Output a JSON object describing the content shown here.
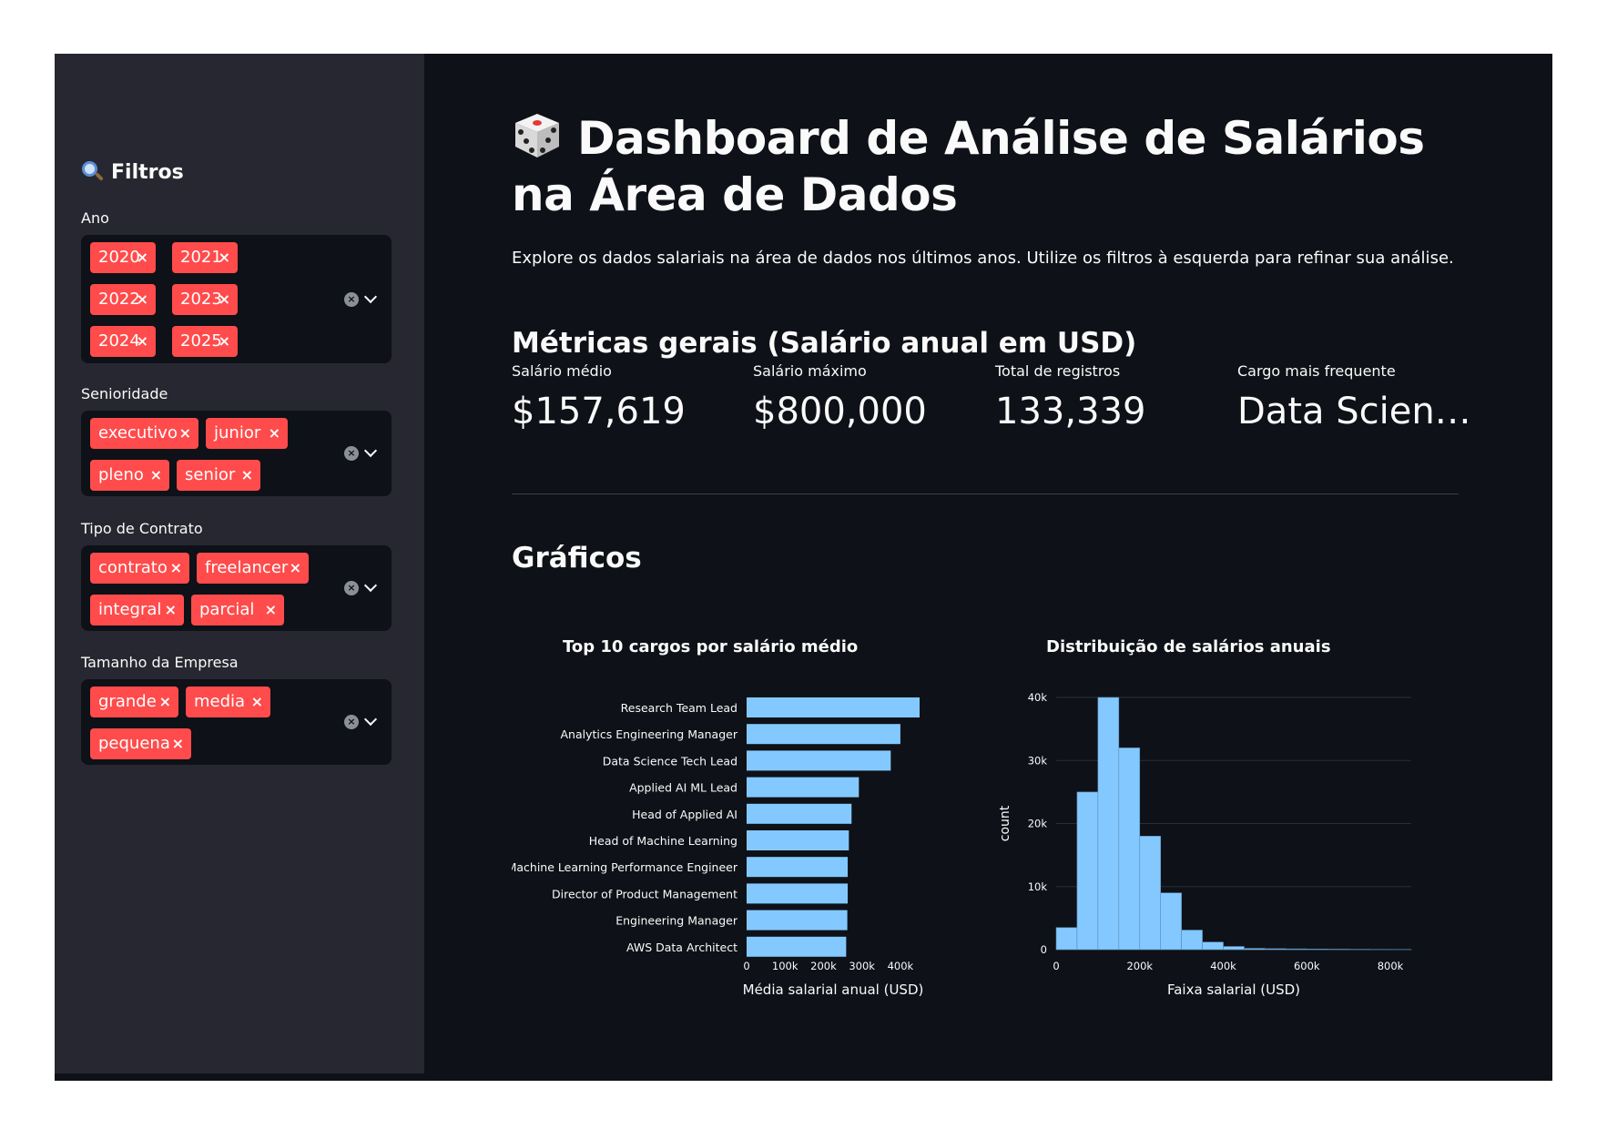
{
  "sidebar": {
    "title": "Filtros",
    "title_icon": "magnifier-icon",
    "filters": {
      "ano": {
        "label": "Ano",
        "tags": [
          "2020",
          "2021",
          "2022",
          "2023",
          "2024",
          "2025"
        ]
      },
      "senioridade": {
        "label": "Senioridade",
        "tags": [
          "executivo",
          "junior",
          "pleno",
          "senior"
        ]
      },
      "contrato": {
        "label": "Tipo de Contrato",
        "tags": [
          "contrato",
          "freelancer",
          "integral",
          "parcial"
        ]
      },
      "empresa": {
        "label": "Tamanho da Empresa",
        "tags": [
          "grande",
          "media",
          "pequena"
        ]
      }
    },
    "tag_color": "#ff4b4b"
  },
  "main": {
    "title": "Dashboard de Análise de Salários na Área de Dados",
    "title_icon": "dice-icon",
    "subtitle": "Explore os dados salariais na área de dados nos últimos anos. Utilize os filtros à esquerda para refinar sua análise.",
    "metrics_heading": "Métricas gerais (Salário anual em USD)",
    "metrics": [
      {
        "label": "Salário médio",
        "value": "$157,619"
      },
      {
        "label": "Salário máximo",
        "value": "$800,000"
      },
      {
        "label": "Total de registros",
        "value": "133,339"
      },
      {
        "label": "Cargo mais frequente",
        "value": "Data Scien…"
      }
    ],
    "charts_heading": "Gráficos"
  },
  "chart_data": [
    {
      "type": "bar",
      "orientation": "horizontal",
      "title": "Top 10 cargos por salário médio",
      "xlabel": "Média salarial anual (USD)",
      "ylabel": "",
      "categories": [
        "Research Team Lead",
        "Analytics Engineering Manager",
        "Data Science Tech Lead",
        "Applied AI ML Lead",
        "Head of Applied AI",
        "Head of Machine Learning",
        "Machine Learning Performance Engineer",
        "Director of Product Management",
        "Engineering Manager",
        "AWS Data Architect"
      ],
      "values": [
        450000,
        400000,
        375000,
        292000,
        273000,
        266000,
        263000,
        263000,
        262000,
        259000
      ],
      "xticks": [
        0,
        100000,
        200000,
        300000,
        400000
      ],
      "xtick_labels": [
        "0",
        "100k",
        "200k",
        "300k",
        "400k"
      ],
      "xlim": [
        0,
        450000
      ],
      "color": "#83c9ff"
    },
    {
      "type": "bar",
      "subtype": "histogram",
      "title": "Distribuição de salários anuais",
      "xlabel": "Faixa salarial (USD)",
      "ylabel": "count",
      "bin_width": 50000,
      "bin_start": 0,
      "values": [
        3500,
        25000,
        40000,
        32000,
        18000,
        9000,
        3100,
        1200,
        500,
        200,
        150,
        120,
        100,
        80,
        60,
        40,
        30
      ],
      "xticks": [
        0,
        200000,
        400000,
        600000,
        800000
      ],
      "xtick_labels": [
        "0",
        "200k",
        "400k",
        "600k",
        "800k"
      ],
      "yticks": [
        0,
        10000,
        20000,
        30000,
        40000
      ],
      "ytick_labels": [
        "0",
        "10k",
        "20k",
        "30k",
        "40k"
      ],
      "xlim": [
        0,
        850000
      ],
      "ylim": [
        0,
        40000
      ],
      "grid": true,
      "color": "#83c9ff"
    }
  ]
}
